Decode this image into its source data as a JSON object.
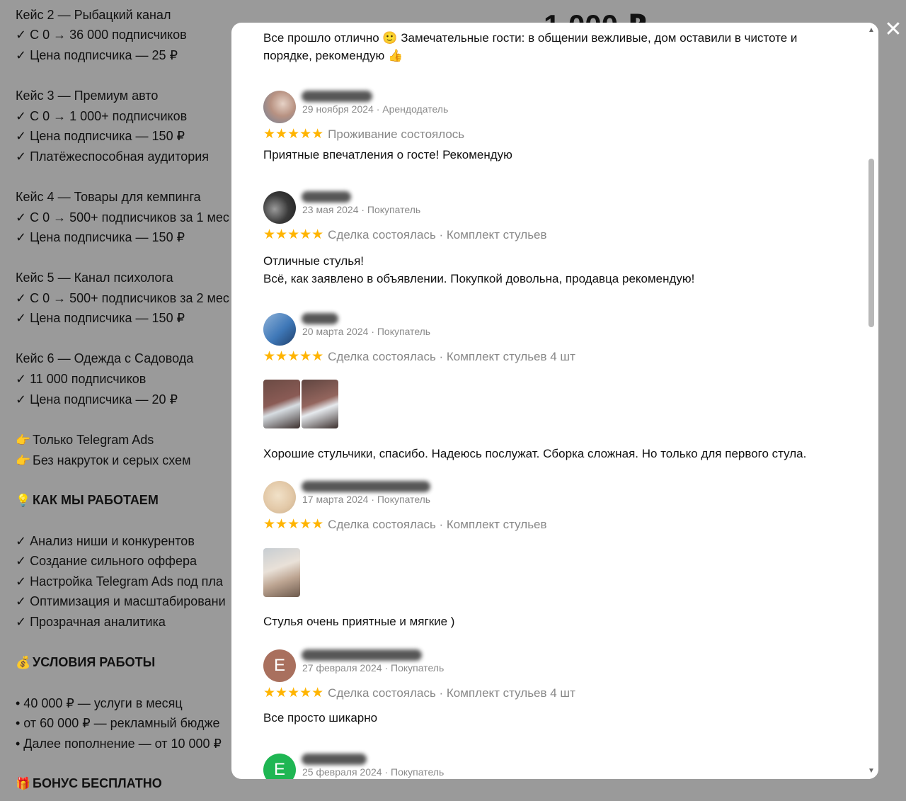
{
  "background": {
    "price_fragment": "1 000 ₽",
    "lines": [
      {
        "text": "Кейс 2 — Рыбацкий канал",
        "heading": false,
        "emoji": ""
      },
      {
        "text": "✓ С 0 → 36 000 подписчиков",
        "heading": false,
        "emoji": ""
      },
      {
        "text": "✓ Цена подписчика — 25 ₽",
        "heading": false,
        "emoji": ""
      },
      {
        "text": "Кейс 3 — Премиум авто",
        "heading": false,
        "emoji": ""
      },
      {
        "text": "✓ С 0 → 1 000+ подписчиков",
        "heading": false,
        "emoji": ""
      },
      {
        "text": "✓ Цена подписчика — 150 ₽",
        "heading": false,
        "emoji": ""
      },
      {
        "text": "✓ Платёжеспособная аудитория",
        "heading": false,
        "emoji": ""
      },
      {
        "text": "Кейс 4 — Товары для кемпинга",
        "heading": false,
        "emoji": ""
      },
      {
        "text": "✓ С 0 → 500+ подписчиков за 1 мес",
        "heading": false,
        "emoji": ""
      },
      {
        "text": "✓ Цена подписчика — 150 ₽",
        "heading": false,
        "emoji": ""
      },
      {
        "text": "Кейс 5 — Канал психолога",
        "heading": false,
        "emoji": ""
      },
      {
        "text": "✓ С 0 → 500+ подписчиков за 2 мес",
        "heading": false,
        "emoji": ""
      },
      {
        "text": "✓ Цена подписчика — 150 ₽",
        "heading": false,
        "emoji": ""
      },
      {
        "text": "Кейс 6 — Одежда с Садовода",
        "heading": false,
        "emoji": ""
      },
      {
        "text": "✓ 11 000 подписчиков",
        "heading": false,
        "emoji": ""
      },
      {
        "text": "✓ Цена подписчика — 20 ₽",
        "heading": false,
        "emoji": ""
      },
      {
        "text": "Только Telegram Ads",
        "heading": false,
        "emoji": "👉"
      },
      {
        "text": "Без накруток и серых схем",
        "heading": false,
        "emoji": "👉"
      },
      {
        "text": "КАК МЫ РАБОТАЕМ",
        "heading": true,
        "emoji": "💡"
      },
      {
        "text": "✓ Анализ ниши и конкурентов",
        "heading": false,
        "emoji": ""
      },
      {
        "text": "✓ Создание сильного оффера",
        "heading": false,
        "emoji": ""
      },
      {
        "text": "✓ Настройка Telegram Ads под пла",
        "heading": false,
        "emoji": ""
      },
      {
        "text": "✓ Оптимизация и масштабировани",
        "heading": false,
        "emoji": ""
      },
      {
        "text": "✓ Прозрачная аналитика",
        "heading": false,
        "emoji": ""
      },
      {
        "text": "УСЛОВИЯ РАБОТЫ",
        "heading": true,
        "emoji": "💰"
      },
      {
        "text": "• 40 000 ₽ — услуги в месяц",
        "heading": false,
        "emoji": ""
      },
      {
        "text": "• от 60 000 ₽ — рекламный бюдже",
        "heading": false,
        "emoji": ""
      },
      {
        "text": "• Далее пополнение — от 10 000 ₽",
        "heading": false,
        "emoji": ""
      },
      {
        "text": "БОНУС БЕСПЛАТНО",
        "heading": true,
        "emoji": "🎁"
      }
    ]
  },
  "modal": {
    "intro_text": "Все прошло отлично 🙂 Замечательные гости: в общении вежливые, дом оставили в чистоте и порядке, рекомендую 👍",
    "reviews": [
      {
        "date_role": "29 ноября 2024 · Арендодатель",
        "stars": "★★★★★",
        "label": "Проживание состоялось",
        "comment": "Приятные впечатления о госте! Рекомендую",
        "avatar_letter": "",
        "avatar_color": "#c9a48e"
      },
      {
        "date_role": "23 мая 2024 · Покупатель",
        "stars": "★★★★★",
        "label": "Сделка состоялась · Комплект стульев",
        "comment": "Отличные стулья!\nВсё, как заявлено в объявлении. Покупкой довольна, продавца рекомендую!",
        "avatar_letter": "",
        "avatar_color": "#3b3b3b"
      },
      {
        "date_role": "20 марта 2024 · Покупатель",
        "stars": "★★★★★",
        "label": "Сделка состоялась · Комплект стульев 4 шт",
        "comment": "Хорошие стульчики, спасибо. Надеюсь послужат. Сборка сложная. Но только для первого стула.",
        "avatar_letter": "",
        "avatar_color": "#3f78b8"
      },
      {
        "date_role": "17 марта 2024 · Покупатель",
        "stars": "★★★★★",
        "label": "Сделка состоялась · Комплект стульев",
        "comment": "Стулья очень приятные и мягкие )",
        "avatar_letter": "",
        "avatar_color": "#e8d2b4"
      },
      {
        "date_role": "27 февраля 2024 · Покупатель",
        "stars": "★★★★★",
        "label": "Сделка состоялась · Комплект стульев 4 шт",
        "comment": "Все просто шикарно",
        "avatar_letter": "Е",
        "avatar_color": "#a9705e"
      },
      {
        "date_role": "25 февраля 2024 · Покупатель",
        "stars": "",
        "label": "",
        "comment": "",
        "avatar_letter": "Е",
        "avatar_color": "#1fb653"
      }
    ]
  },
  "close_icon": "✕",
  "colors": {
    "overlay": "#9a9a9a",
    "star": "#ffb400",
    "meta": "#8a8a8a"
  }
}
